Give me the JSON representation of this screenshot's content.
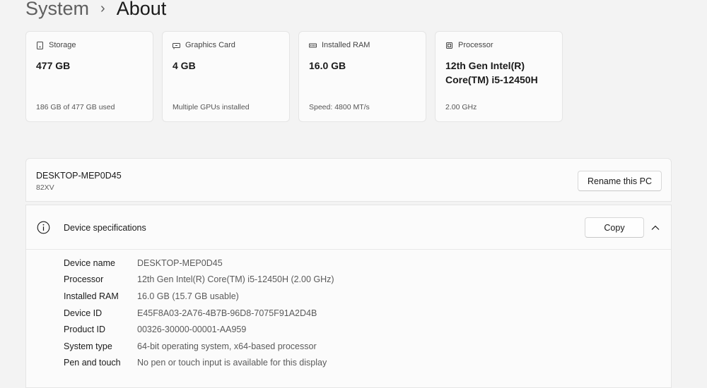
{
  "breadcrumb": {
    "parent": "System",
    "separator": "›",
    "current": "About"
  },
  "cards": [
    {
      "icon": "storage-icon",
      "label": "Storage",
      "value": "477 GB",
      "sub": "186 GB of 477 GB used"
    },
    {
      "icon": "graphics-card-icon",
      "label": "Graphics Card",
      "value": "4 GB",
      "sub": "Multiple GPUs installed"
    },
    {
      "icon": "ram-icon",
      "label": "Installed RAM",
      "value": "16.0 GB",
      "sub": "Speed: 4800 MT/s"
    },
    {
      "icon": "processor-icon",
      "label": "Processor",
      "value": "12th Gen Intel(R) Core(TM) i5-12450H",
      "sub": "2.00 GHz"
    }
  ],
  "pc": {
    "name": "DESKTOP-MEP0D45",
    "model": "82XV",
    "rename_label": "Rename this PC"
  },
  "device_specs": {
    "title": "Device specifications",
    "copy_label": "Copy",
    "rows": [
      {
        "label": "Device name",
        "value": "DESKTOP-MEP0D45"
      },
      {
        "label": "Processor",
        "value": "12th Gen Intel(R) Core(TM) i5-12450H (2.00 GHz)"
      },
      {
        "label": "Installed RAM",
        "value": "16.0 GB (15.7 GB usable)"
      },
      {
        "label": "Device ID",
        "value": "E45F8A03-2A76-4B7B-96D8-7075F91A2D4B"
      },
      {
        "label": "Product ID",
        "value": "00326-30000-00001-AA959"
      },
      {
        "label": "System type",
        "value": "64-bit operating system, x64-based processor"
      },
      {
        "label": "Pen and touch",
        "value": "No pen or touch input is available for this display"
      }
    ]
  },
  "colors": {
    "background": "#f3f3f3",
    "card": "#fbfbfb",
    "border": "#e5e5e5"
  }
}
